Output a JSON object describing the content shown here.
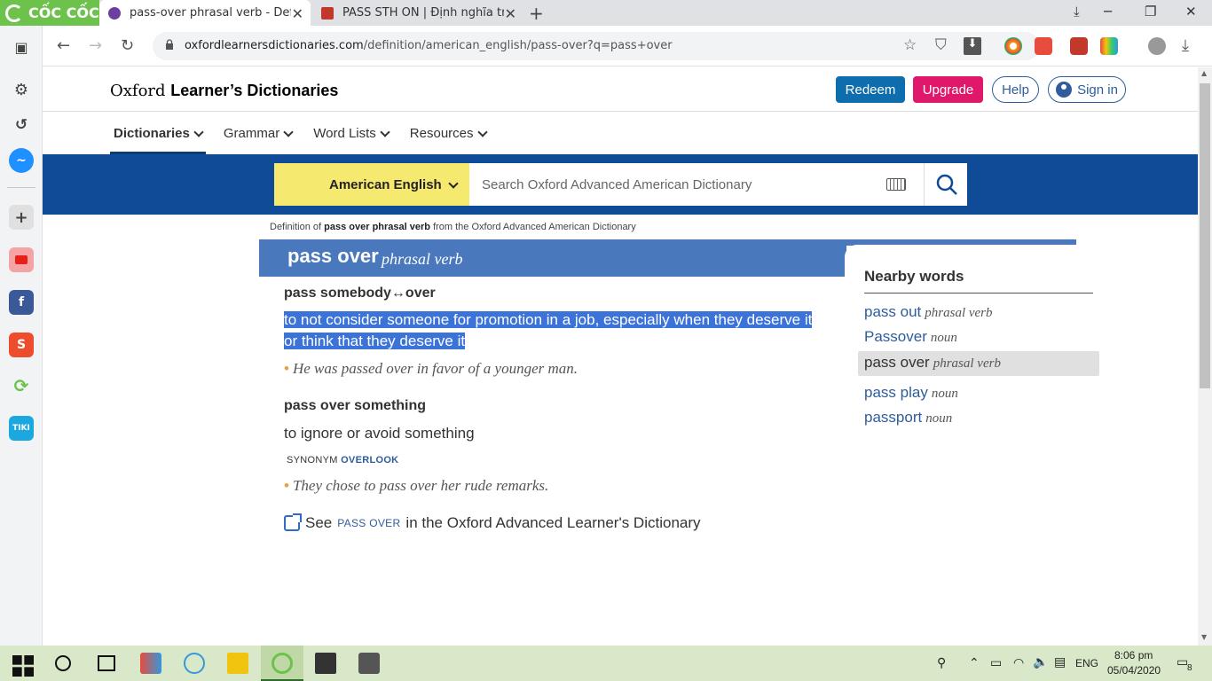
{
  "browser": {
    "brand": "CỐC CỐC",
    "tabs": [
      {
        "title": "pass-over phrasal verb - Defi",
        "close": "✕"
      },
      {
        "title": "PASS STH ON | Định nghĩa tro",
        "close": "✕"
      }
    ],
    "new_tab": "+",
    "window_controls": {
      "restore_down": "⤓",
      "minimize": "─",
      "maximize": "❐",
      "close": "✕"
    },
    "url_domain": "oxfordlearnersdictionaries.com",
    "url_path": "/definition/american_english/pass-over?q=pass+over",
    "colors": {
      "brand_green": "#6cc24a",
      "tab_strip": "#dfe1e5"
    }
  },
  "site": {
    "logo_plain": "Oxford",
    "logo_bold": "Learner’s Dictionaries",
    "buttons": {
      "redeem": "Redeem",
      "upgrade": "Upgrade",
      "help": "Help",
      "signin": "Sign in"
    },
    "nav": [
      {
        "label": "Dictionaries",
        "active": true
      },
      {
        "label": "Grammar"
      },
      {
        "label": "Word Lists"
      },
      {
        "label": "Resources"
      }
    ],
    "search": {
      "dictionary": "American English",
      "placeholder": "Search Oxford Advanced American Dictionary",
      "value": ""
    },
    "colors": {
      "band": "#0f4b96",
      "select": "#f6e96f",
      "headbar": "#4a78bd",
      "redeem": "#0e6ead",
      "upgrade": "#e0186c"
    }
  },
  "entry": {
    "def_of_prefix": "Definition of",
    "def_of_term": "pass over phrasal verb",
    "def_of_suffix": "from the Oxford Advanced American Dictionary",
    "headword": "pass over",
    "pos": "phrasal verb",
    "senses": [
      {
        "pattern": "pass somebody↔over",
        "definition_line1": "to not consider someone for promotion in a job, especially when they deserve it",
        "definition_line2": "or think that they deserve it",
        "example": "He was passed over in favor of a younger man."
      },
      {
        "pattern": "pass over something",
        "definition": "to ignore or avoid something",
        "synonym_label": "SYNONYM",
        "synonym": "OVERLOOK",
        "example": "They chose to pass over her rude remarks."
      }
    ],
    "see_also": {
      "prefix": "See",
      "link": "pass over",
      "suffix": "in the Oxford Advanced Learner's Dictionary"
    },
    "bullet": "•"
  },
  "nearby": {
    "title": "Nearby words",
    "items": [
      {
        "word": "pass out",
        "pos": "phrasal verb"
      },
      {
        "word": "Passover",
        "pos": "noun"
      },
      {
        "word": "pass over",
        "pos": "phrasal verb",
        "current": true
      },
      {
        "word": "pass play",
        "pos": "noun"
      },
      {
        "word": "passport",
        "pos": "noun"
      }
    ]
  },
  "taskbar": {
    "language": "ENG",
    "time": "8:06 pm",
    "date": "05/04/2020",
    "notifications": "8"
  }
}
